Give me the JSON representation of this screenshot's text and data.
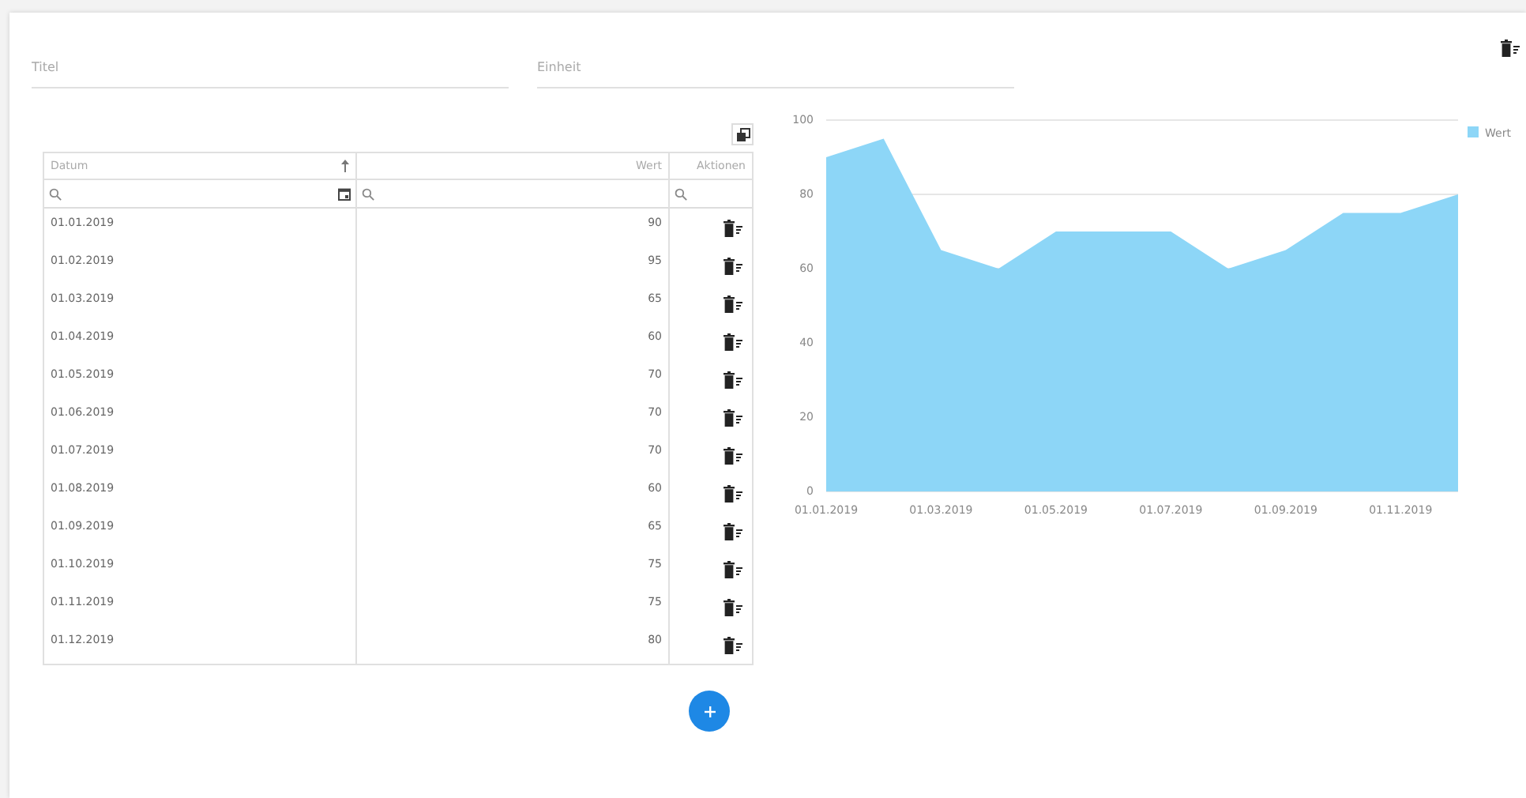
{
  "form": {
    "fields": [
      {
        "placeholder": "Titel"
      },
      {
        "placeholder": "Einheit"
      }
    ]
  },
  "table": {
    "columns": [
      {
        "label": "Datum",
        "sorted": true,
        "kind": "date"
      },
      {
        "label": "Wert",
        "sorted": false,
        "kind": "text"
      },
      {
        "label": "Aktionen",
        "sorted": false,
        "kind": "text"
      }
    ],
    "rows": [
      {
        "date": "01.01.2019",
        "value": "90"
      },
      {
        "date": "01.02.2019",
        "value": "95"
      },
      {
        "date": "01.03.2019",
        "value": "65"
      },
      {
        "date": "01.04.2019",
        "value": "60"
      },
      {
        "date": "01.05.2019",
        "value": "70"
      },
      {
        "date": "01.06.2019",
        "value": "70"
      },
      {
        "date": "01.07.2019",
        "value": "70"
      },
      {
        "date": "01.08.2019",
        "value": "60"
      },
      {
        "date": "01.09.2019",
        "value": "65"
      },
      {
        "date": "01.10.2019",
        "value": "75"
      },
      {
        "date": "01.11.2019",
        "value": "75"
      },
      {
        "date": "01.12.2019",
        "value": "80"
      }
    ]
  },
  "chart_data": {
    "type": "area",
    "series": [
      {
        "name": "Wert",
        "color": "#8dd6f7",
        "values": [
          90,
          95,
          65,
          60,
          70,
          70,
          70,
          60,
          65,
          75,
          75,
          80
        ]
      }
    ],
    "ylim": [
      0,
      100
    ],
    "yticks": [
      0,
      20,
      40,
      60,
      80,
      100
    ],
    "categories": [
      "01.01.2019",
      null,
      "01.03.2019",
      null,
      "01.05.2019",
      null,
      "01.07.2019",
      null,
      "01.09.2019",
      null,
      "01.11.2019",
      null
    ]
  }
}
